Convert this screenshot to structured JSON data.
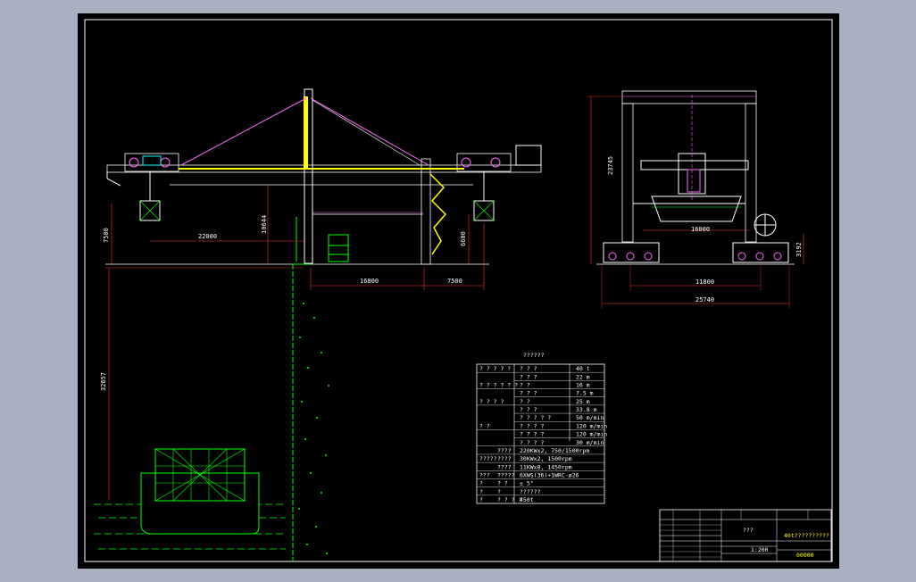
{
  "crane_elevation": {
    "dimensions": {
      "outreach": "22000",
      "gauge": "16800",
      "backreach": "7500",
      "lift_above_rail": "10644",
      "left_height": "7500",
      "portal_clear": "6600",
      "below_rail": "32657"
    }
  },
  "end_view": {
    "dimensions": {
      "total_height": "23745",
      "inner_width": "16000",
      "base_width": "11800",
      "overall_width": "25740",
      "bogie_height": "3192"
    }
  },
  "spec_table": {
    "title": "??????",
    "rows": [
      {
        "c1": "? ? ? ? ?",
        "c2": "? ? ?",
        "c3": "40 t"
      },
      {
        "c1": "",
        "c2": "? ? ?",
        "c3": "22 m"
      },
      {
        "c1": "? ? ? ? ? ?",
        "c2": "? ?",
        "c3": "16 m"
      },
      {
        "c1": "",
        "c2": "? ? ?",
        "c3": "7.5 m"
      },
      {
        "c1": "? ? ? ?",
        "c2": "? ?",
        "c3": "25 m"
      },
      {
        "c1": "",
        "c2": "? ? ?",
        "c3": "33.8 m"
      },
      {
        "c1": "",
        "c2": "? ? ? ? ?",
        "c3": "50 m/min"
      },
      {
        "c1": "?     ?",
        "c2": "? ? ? ?",
        "c3": "120 m/min"
      },
      {
        "c1": "",
        "c2": "? ? ? ?",
        "c3": "120 m/min"
      },
      {
        "c1": "",
        "c2": "? ? ? ?",
        "c3": "30 m/min"
      },
      {
        "c1": "",
        "c2": "????",
        "c3": "220KWx2, 750/1500rpm"
      },
      {
        "c1": "?????",
        "c2": "????",
        "c3": "30KWx2, 1500rpm"
      },
      {
        "c1": "",
        "c2": "????",
        "c3": "11KWx8, 1450rpm"
      },
      {
        "c1": "???",
        "c2": "?????",
        "c3": "6XWS(36)+1WRC-ø26"
      },
      {
        "c1": "?",
        "c2": "? ?",
        "c3": "± 5°"
      },
      {
        "c1": "?",
        "c2": "?",
        "c3": "??????"
      },
      {
        "c1": "?",
        "c2": "? ? ? ?",
        "c3": "450t"
      }
    ]
  },
  "title_block": {
    "drawing_title": "40t??????????",
    "designation": "???",
    "mark": "00000",
    "scale": "1:200"
  }
}
